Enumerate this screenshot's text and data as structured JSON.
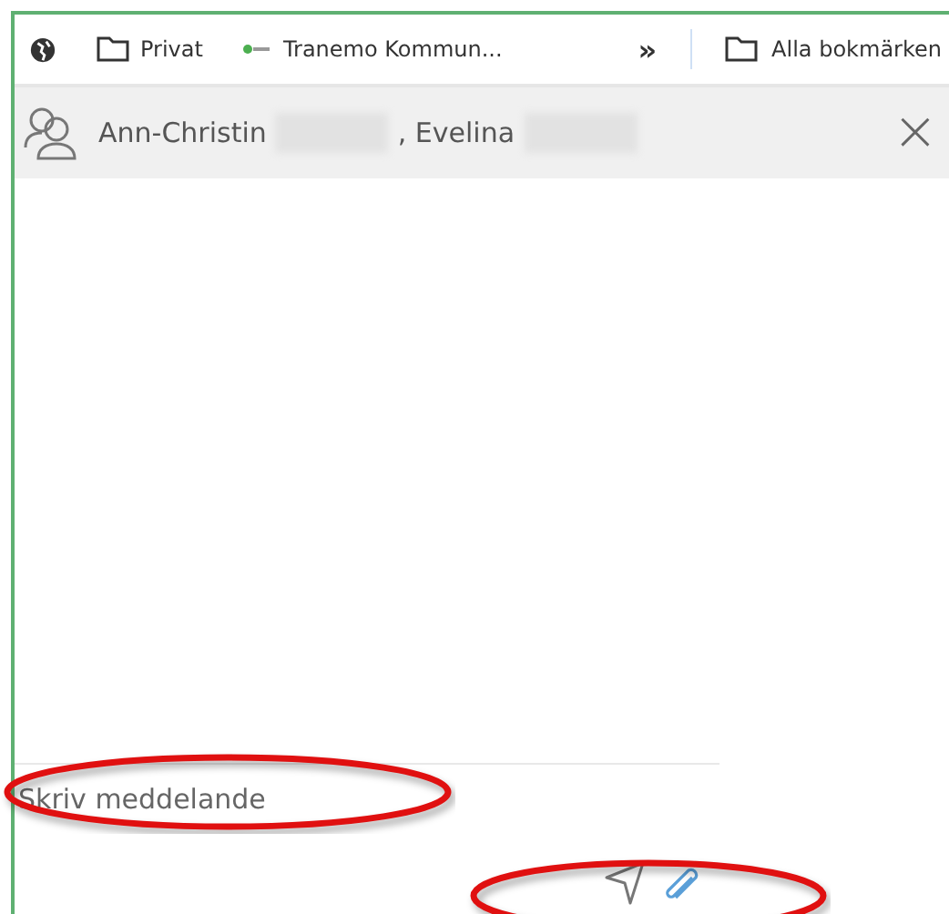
{
  "bookmarks_bar": {
    "items": [
      {
        "kind": "globe"
      },
      {
        "kind": "folder",
        "label": "Privat"
      },
      {
        "kind": "site",
        "label": "Tranemo Kommun..."
      }
    ],
    "overflow": "»",
    "all_bookmarks": "Alla bokmärken"
  },
  "conversation": {
    "participants": [
      {
        "text": "Ann-Christin",
        "blurred": true
      },
      {
        "text": ", Evelina",
        "blurred": true
      }
    ],
    "close": "×"
  },
  "compose": {
    "placeholder": "Skriv meddelande",
    "placeholder_circled": true,
    "actions_circled": true
  }
}
